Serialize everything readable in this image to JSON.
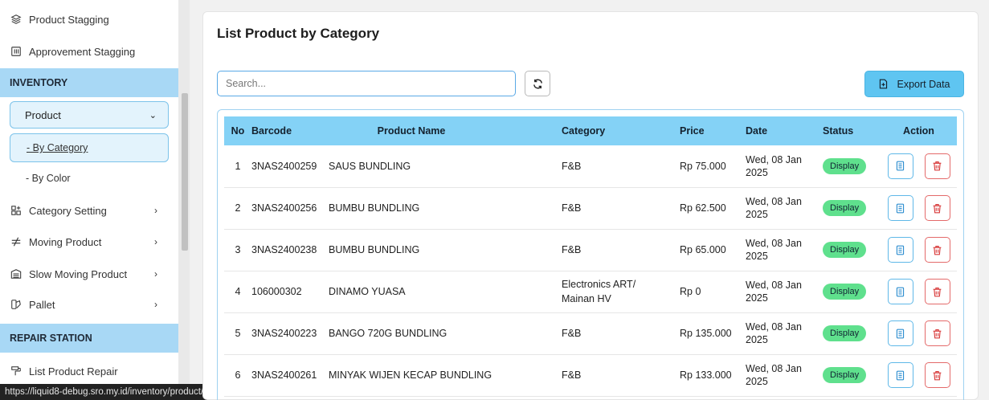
{
  "sidebar": {
    "top_items": [
      {
        "label": "Product Stagging",
        "icon": "layers-icon"
      },
      {
        "label": "Approvement Stagging",
        "icon": "columns-icon"
      }
    ],
    "inventory_section": "INVENTORY",
    "product": {
      "label": "Product",
      "icon": "cubes-icon"
    },
    "sub_items": [
      "- By Category",
      "- By Color"
    ],
    "inventory_items": [
      {
        "label": "Category Setting",
        "icon": "grid-plus-icon"
      },
      {
        "label": "Moving Product",
        "icon": "arrows-icon"
      },
      {
        "label": "Slow Moving Product",
        "icon": "warehouse-icon"
      },
      {
        "label": "Pallet",
        "icon": "pallet-icon"
      }
    ],
    "repair_section": "REPAIR STATION",
    "repair_items": [
      {
        "label": "List Product Repair",
        "icon": "repair-icon"
      }
    ]
  },
  "status_url": "https://liquid8-debug.sro.my.id/inventory/product/category",
  "main": {
    "title": "List Product by Category",
    "search_placeholder": "Search...",
    "export_label": "Export Data",
    "table": {
      "headers": {
        "no": "No",
        "barcode": "Barcode",
        "name": "Product Name",
        "category": "Category",
        "price": "Price",
        "date": "Date",
        "status": "Status",
        "action": "Action"
      },
      "rows": [
        {
          "no": "1",
          "barcode": "3NAS2400259",
          "name": "SAUS BUNDLING",
          "category": "F&B",
          "price": "Rp 75.000",
          "date": "Wed, 08 Jan 2025",
          "status": "Display"
        },
        {
          "no": "2",
          "barcode": "3NAS2400256",
          "name": "BUMBU BUNDLING",
          "category": "F&B",
          "price": "Rp 62.500",
          "date": "Wed, 08 Jan 2025",
          "status": "Display"
        },
        {
          "no": "3",
          "barcode": "3NAS2400238",
          "name": "BUMBU BUNDLING",
          "category": "F&B",
          "price": "Rp 65.000",
          "date": "Wed, 08 Jan 2025",
          "status": "Display"
        },
        {
          "no": "4",
          "barcode": "106000302",
          "name": "DINAMO YUASA",
          "category": "Electronics ART/ Mainan HV",
          "price": "Rp 0",
          "date": "Wed, 08 Jan 2025",
          "status": "Display"
        },
        {
          "no": "5",
          "barcode": "3NAS2400223",
          "name": "BANGO 720G BUNDLING",
          "category": "F&B",
          "price": "Rp 135.000",
          "date": "Wed, 08 Jan 2025",
          "status": "Display"
        },
        {
          "no": "6",
          "barcode": "3NAS2400261",
          "name": "MINYAK WIJEN KECAP BUNDLING",
          "category": "F&B",
          "price": "Rp 133.000",
          "date": "Wed, 08 Jan 2025",
          "status": "Display"
        }
      ]
    }
  },
  "colors": {
    "section_bg": "#a8d8f5",
    "header_bg": "#84d2f6",
    "badge_green": "#5fe08d",
    "export_bg": "#5fc5f1"
  }
}
